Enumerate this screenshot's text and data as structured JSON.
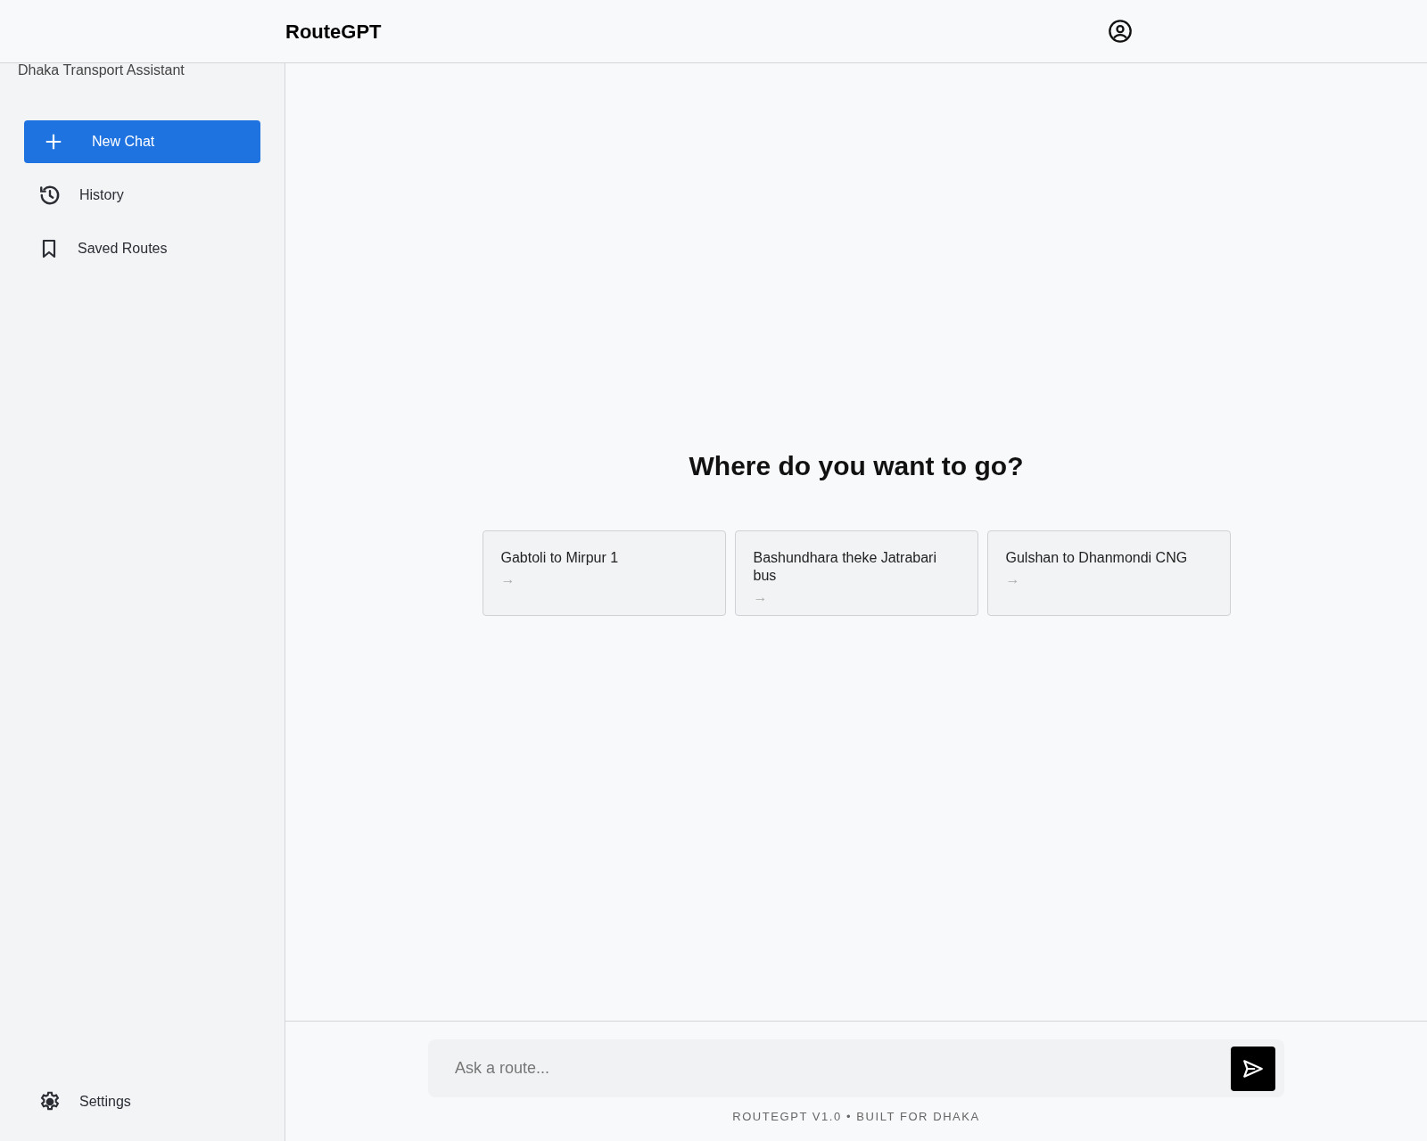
{
  "header": {
    "title": "RouteGPT"
  },
  "sidebar": {
    "subtitle": "Dhaka Transport Assistant",
    "items": [
      {
        "kind": "new",
        "label": "New Chat",
        "selected": true
      },
      {
        "kind": "history",
        "label": "History",
        "selected": false
      },
      {
        "kind": "saved",
        "label": "Saved Routes",
        "selected": false
      }
    ],
    "settings": {
      "label": "Settings"
    }
  },
  "main": {
    "heading": "Where do you want to go?",
    "suggestions": [
      {
        "text": "Gabtoli to Mirpur 1",
        "arrow": "→"
      },
      {
        "text": "Bashundhara theke Jatrabari bus",
        "arrow": "→"
      },
      {
        "text": "Gulshan to Dhanmondi CNG",
        "arrow": "→"
      }
    ]
  },
  "composer": {
    "placeholder": "Ask a route...",
    "footer": "ROUTEGPT V1.0 • BUILT FOR DHAKA"
  }
}
